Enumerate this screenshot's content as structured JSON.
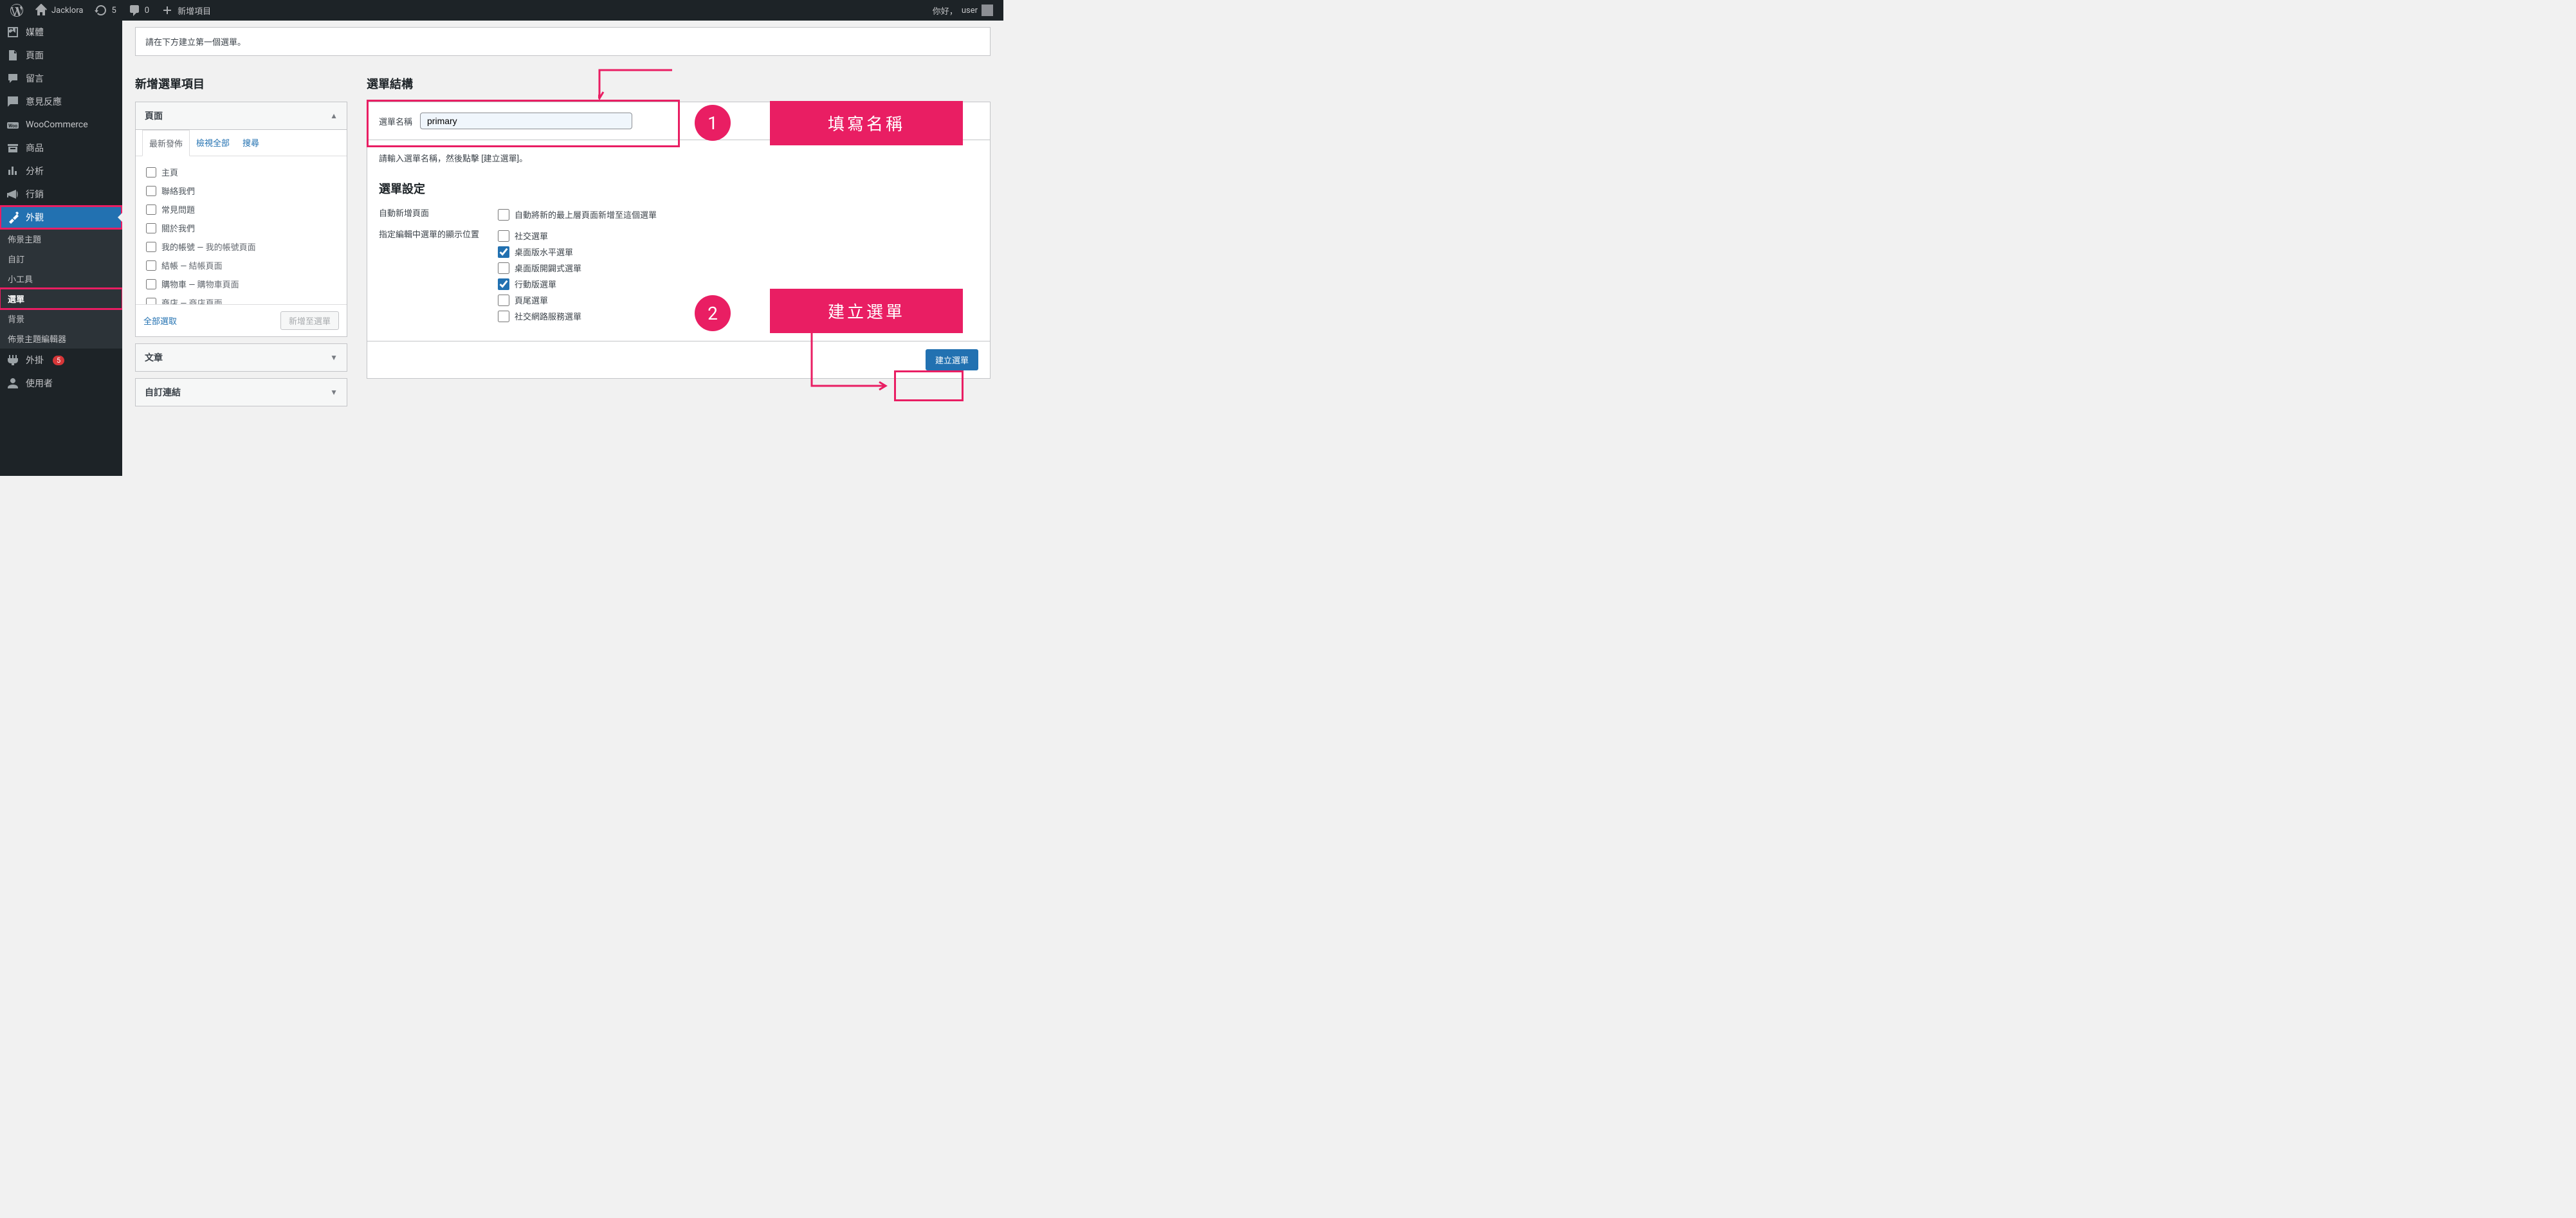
{
  "adminbar": {
    "site_name": "Jacklora",
    "updates": "5",
    "comments": "0",
    "new_item": "新增項目",
    "greeting": "你好，",
    "username": "user"
  },
  "sidebar": {
    "items": [
      {
        "label": "媒體",
        "icon": "media"
      },
      {
        "label": "頁面",
        "icon": "page"
      },
      {
        "label": "留言",
        "icon": "comment"
      },
      {
        "label": "意見反應",
        "icon": "feedback"
      },
      {
        "label": "WooCommerce",
        "icon": "woo"
      },
      {
        "label": "商品",
        "icon": "product"
      },
      {
        "label": "分析",
        "icon": "analytics"
      },
      {
        "label": "行銷",
        "icon": "marketing"
      },
      {
        "label": "外觀",
        "icon": "appearance",
        "current": true
      },
      {
        "label": "外掛",
        "icon": "plugins",
        "badge": "5"
      },
      {
        "label": "使用者",
        "icon": "users"
      }
    ],
    "subitems": [
      {
        "label": "佈景主題"
      },
      {
        "label": "自訂"
      },
      {
        "label": "小工具"
      },
      {
        "label": "選單",
        "current": true
      },
      {
        "label": "背景"
      },
      {
        "label": "佈景主題編輯器"
      }
    ]
  },
  "notice": "請在下方建立第一個選單。",
  "headings": {
    "add_items": "新增選單項目",
    "structure": "選單結構"
  },
  "accordions": {
    "pages": "頁面",
    "posts": "文章",
    "custom_links": "自訂連結"
  },
  "tabs": {
    "recent": "最新發佈",
    "view_all": "檢視全部",
    "search": "搜尋"
  },
  "page_items": [
    {
      "main": "主頁"
    },
    {
      "main": "聯絡我們"
    },
    {
      "main": "常見問題"
    },
    {
      "main": "關於我們"
    },
    {
      "main": "我的帳號",
      "sub": "我的帳號頁面"
    },
    {
      "main": "結帳",
      "sub": "結帳頁面"
    },
    {
      "main": "購物車",
      "sub": "購物車頁面"
    },
    {
      "main": "商店",
      "sub": "商店頁面"
    }
  ],
  "select_all": "全部選取",
  "add_to_menu": "新增至選單",
  "menu_name_label": "選單名稱",
  "menu_name_value": "primary",
  "hint": "請輸入選單名稱，然後點擊 [建立選單]。",
  "settings_title": "選單設定",
  "auto_add_label": "自動新增頁面",
  "auto_add_opt": "自動將新的最上層頁面新增至這個選單",
  "display_label": "指定編輯中選單的顯示位置",
  "locations": [
    {
      "label": "社交選單",
      "checked": false
    },
    {
      "label": "桌面版水平選單",
      "checked": true
    },
    {
      "label": "桌面版開闢式選單",
      "checked": false
    },
    {
      "label": "行動版選單",
      "checked": true
    },
    {
      "label": "頁尾選單",
      "checked": false
    },
    {
      "label": "社交網路服務選單",
      "checked": false
    }
  ],
  "create_btn": "建立選單",
  "annotations": {
    "step1": "1",
    "step1_label": "填寫名稱",
    "step2": "2",
    "step2_label": "建立選單"
  }
}
